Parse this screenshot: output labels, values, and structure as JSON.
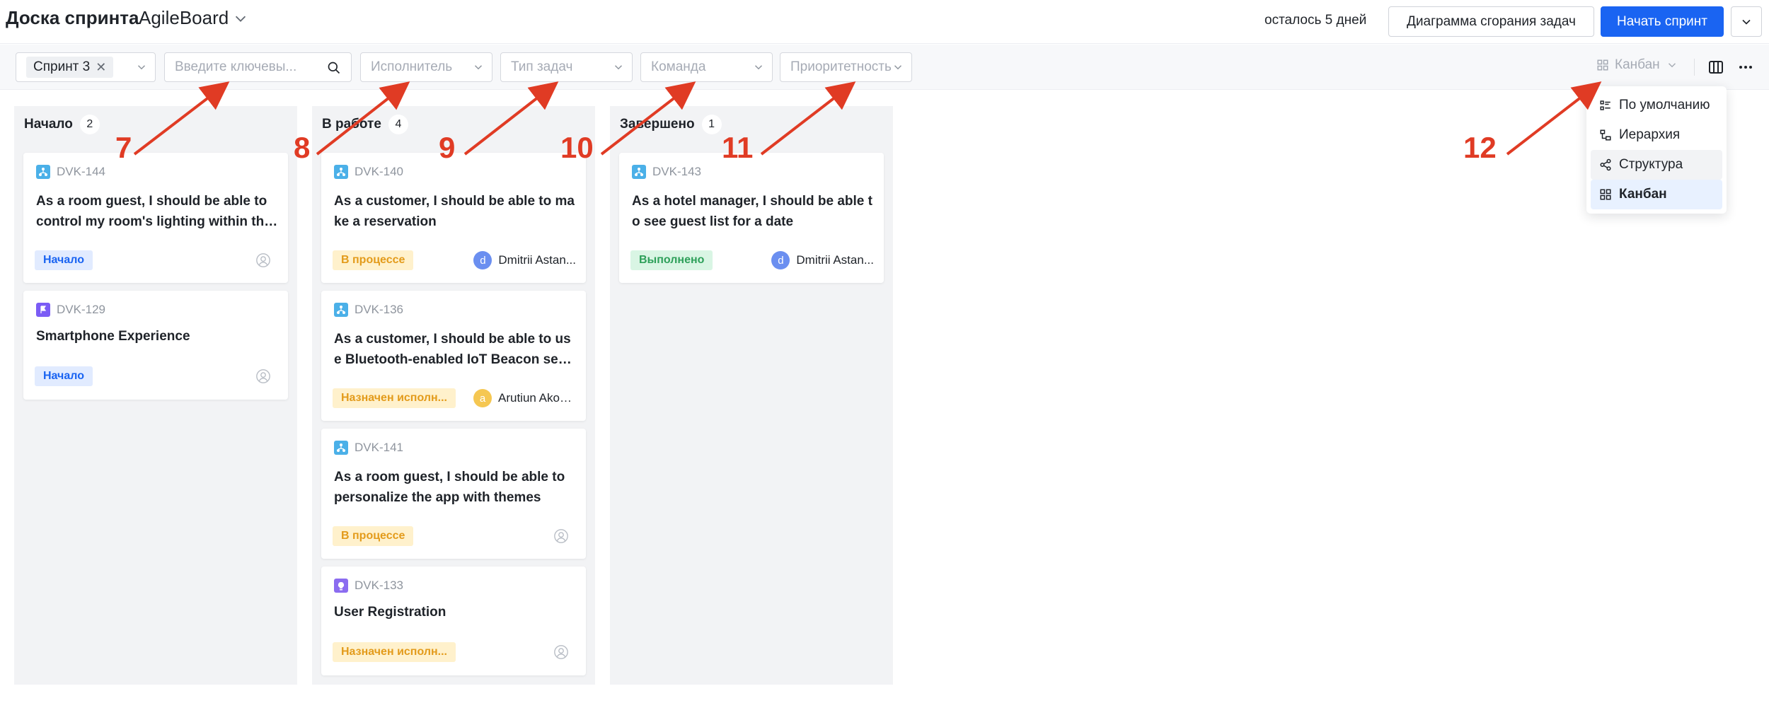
{
  "header": {
    "title": "Доска спринта",
    "board_name": "AgileBoard",
    "days_left": "осталось 5 дней",
    "burndown_label": "Диаграмма сгорания задач",
    "start_sprint_label": "Начать спринт"
  },
  "filters": {
    "sprint_chip": "Спринт 3",
    "search_placeholder": "Введите ключевы...",
    "assignee_placeholder": "Исполнитель",
    "task_type_placeholder": "Тип задач",
    "team_placeholder": "Команда",
    "priority_placeholder": "Приоритетность",
    "view_label": "Канбан"
  },
  "view_menu": {
    "items": [
      "По умолчанию",
      "Иерархия",
      "Структура",
      "Канбан"
    ],
    "hovered": "Структура",
    "selected": "Канбан"
  },
  "columns": [
    {
      "title": "Начало",
      "count": "2",
      "cards": [
        {
          "key": "DVK-144",
          "type": "story",
          "title": "As a room guest, I should be able to control my room's lighting within the app",
          "status": "Начало",
          "assignee": ""
        },
        {
          "key": "DVK-129",
          "type": "epic",
          "title": "Smartphone Experience",
          "status": "Начало",
          "assignee": ""
        }
      ]
    },
    {
      "title": "В работе",
      "count": "4",
      "cards": [
        {
          "key": "DVK-140",
          "type": "story",
          "title": "As a customer, I should be able to make a reservation",
          "status": "В процессе",
          "assignee": "Dmitrii Astan...",
          "avatar": "d"
        },
        {
          "key": "DVK-136",
          "type": "story",
          "title": "As a customer, I should be able to use Bluetooth-enabled IoT Beacon sensors",
          "status": "Назначен исполн...",
          "assignee": "Arutiun Akop...",
          "avatar": "a"
        },
        {
          "key": "DVK-141",
          "type": "story",
          "title": "As a room guest, I should be able to personalize the app with themes",
          "status": "В процессе",
          "assignee": ""
        },
        {
          "key": "DVK-133",
          "type": "feature",
          "title": "User Registration",
          "status": "Назначен исполн...",
          "assignee": ""
        }
      ]
    },
    {
      "title": "Завершено",
      "count": "1",
      "cards": [
        {
          "key": "DVK-143",
          "type": "story",
          "title": "As a hotel manager, I should be able to see guest list for a date",
          "status": "Выполнено",
          "assignee": "Dmitrii Astan...",
          "avatar": "d"
        }
      ]
    }
  ],
  "annotations": [
    "7",
    "8",
    "9",
    "10",
    "11",
    "12"
  ],
  "colors": {
    "primary": "#1a64f2",
    "annotation": "#e03b24",
    "story_icon": "#4bb0e8",
    "epic_icon": "#7b5cf5",
    "feature_icon": "#8b6cf0",
    "avatar_d": "#6b8ff0",
    "avatar_a": "#f5c752"
  }
}
